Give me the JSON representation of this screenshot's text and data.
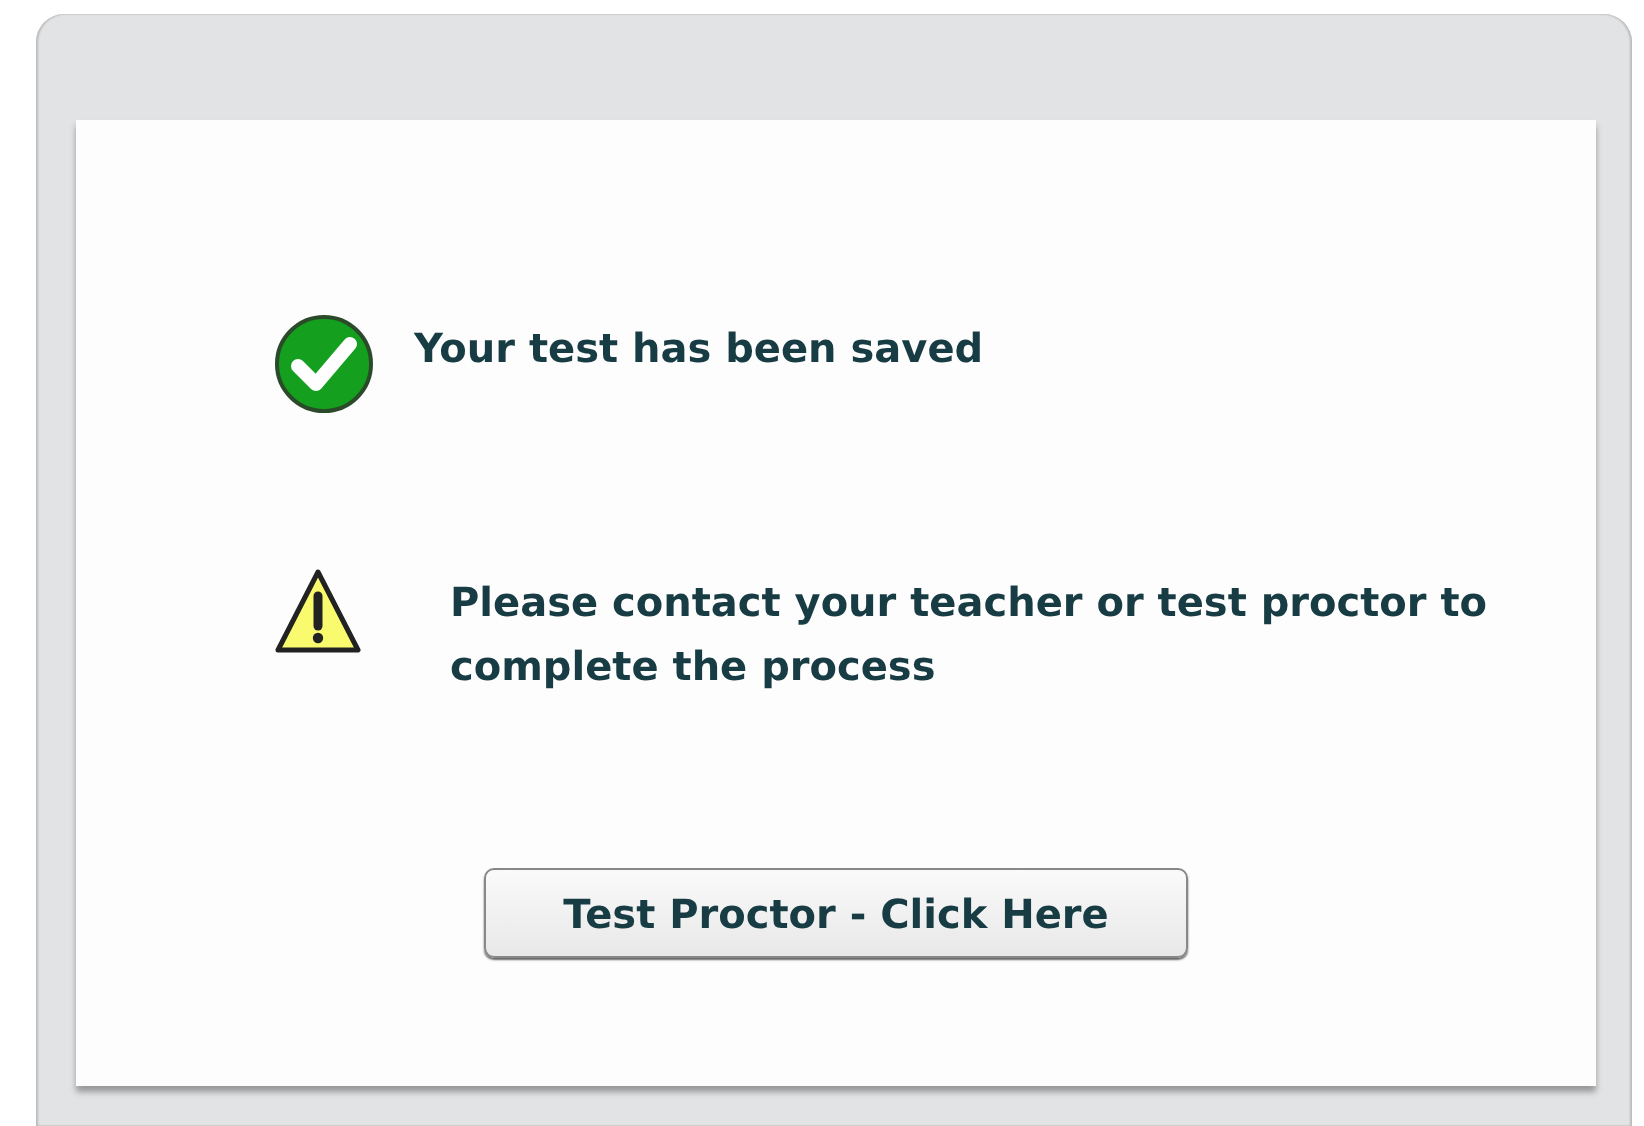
{
  "messages": [
    {
      "kind": "success",
      "text": "Your test has been saved"
    },
    {
      "kind": "warning",
      "text": "Please contact your teacher or test proctor to complete the process"
    }
  ],
  "button": {
    "label": "Test Proctor - Click Here"
  }
}
